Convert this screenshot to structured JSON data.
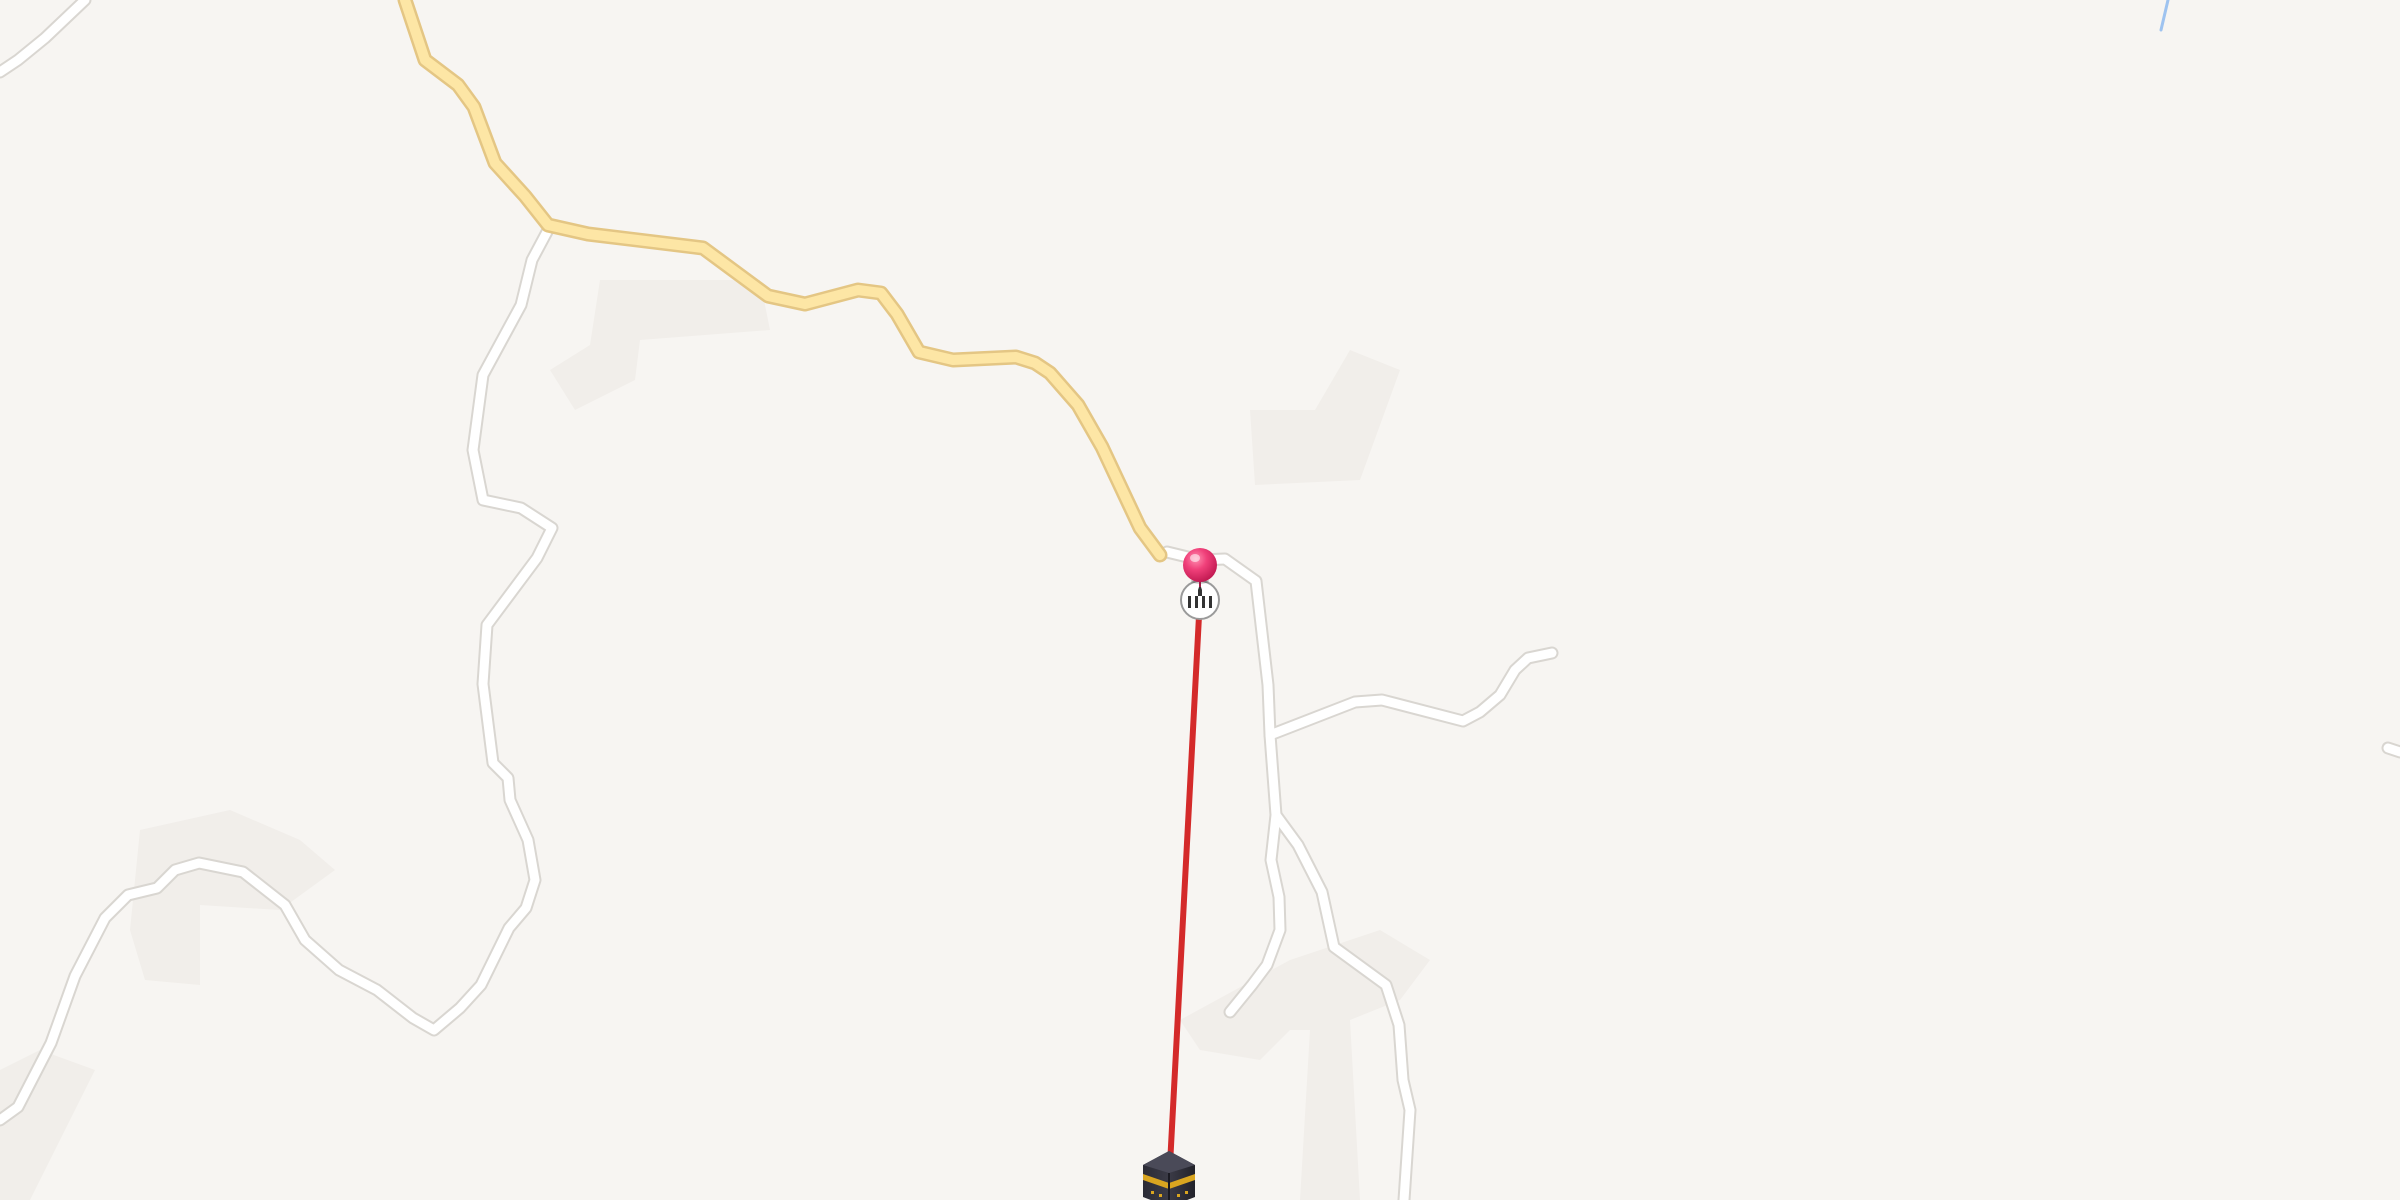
{
  "map": {
    "background_color": "#f7f5f2",
    "landcover_color": "#f1eeea",
    "minor_road_fill": "#ffffff",
    "minor_road_casing": "#d9d6d1",
    "major_road_fill": "#fde6a5",
    "major_road_casing": "#e4c684",
    "water_color": "#9ec3f0",
    "qibla_line_color": "#d42a2a",
    "pin_color": "#e8306b"
  },
  "markers": {
    "location_pin": {
      "icon": "location-pin-icon"
    },
    "compass": {
      "icon": "mosque-compass-icon"
    },
    "kaaba": {
      "icon": "kaaba-icon"
    }
  },
  "overlays": {
    "qibla_line": {
      "icon": "qibla-direction-line"
    }
  }
}
